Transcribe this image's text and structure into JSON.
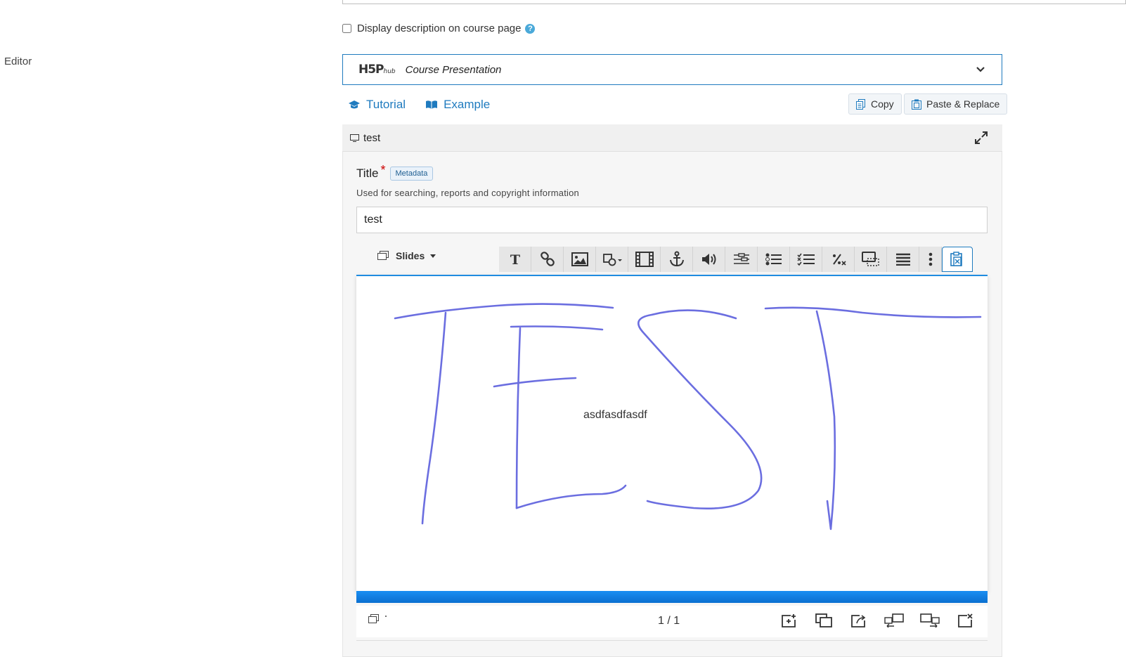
{
  "description_checkbox": {
    "label": "Display description on course page",
    "checked": false
  },
  "editor_label": "Editor",
  "hub": {
    "logo_main": "H5P",
    "logo_sub": "hub",
    "content_type": "Course Presentation"
  },
  "links": {
    "tutorial": "Tutorial",
    "example": "Example"
  },
  "actions": {
    "copy": "Copy",
    "paste_replace": "Paste & Replace"
  },
  "panel": {
    "title": "test"
  },
  "title_field": {
    "label": "Title",
    "required_mark": "*",
    "metadata_label": "Metadata",
    "description": "Used for searching, reports and copyright information",
    "value": "test"
  },
  "slides_tab": {
    "label": "Slides"
  },
  "toolbar": {
    "items": [
      "text-icon",
      "link-icon",
      "image-icon",
      "shapes-icon",
      "video-icon",
      "anchor-icon",
      "audio-icon",
      "fill-blanks-icon",
      "single-choice-icon",
      "multi-choice-icon",
      "mark-words-icon",
      "drag-drop-icon",
      "summary-icon",
      "more-icon",
      "paste-icon"
    ]
  },
  "slide": {
    "text": "asdfasdfasdf",
    "drawing_color": "#6b6ee0"
  },
  "pager": {
    "current": "1",
    "separator": "/",
    "total": "1"
  },
  "colors": {
    "accent": "#1f7bbf",
    "progress": "#0b7ae0"
  }
}
